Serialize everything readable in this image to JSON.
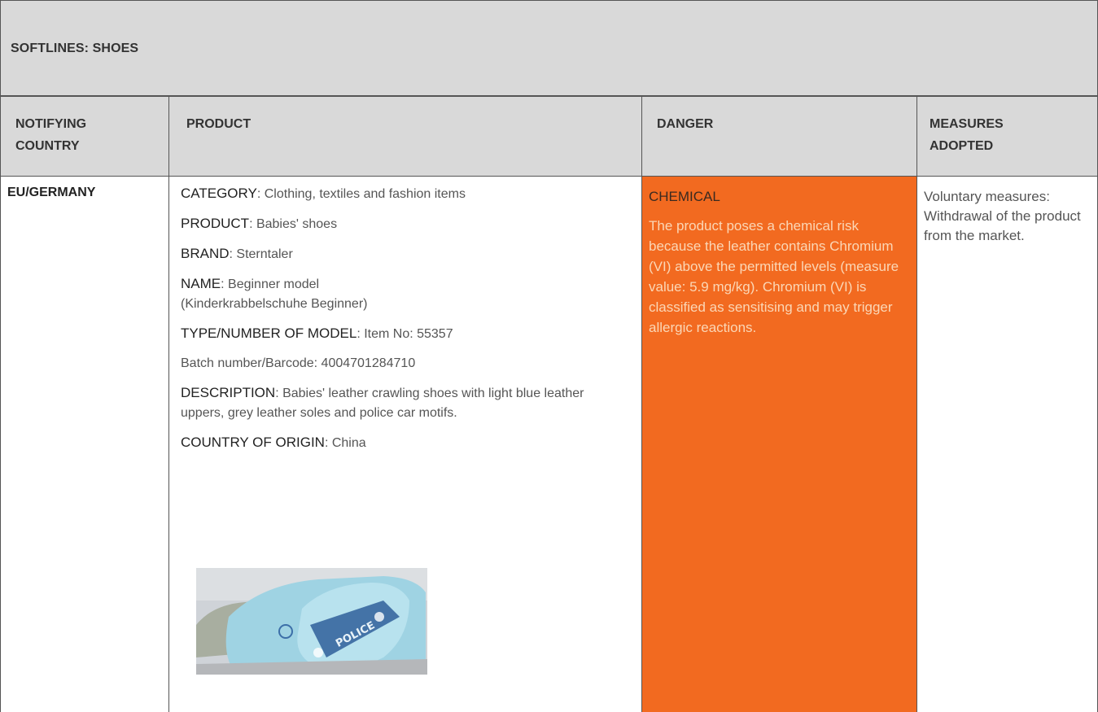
{
  "section": {
    "title": "SOFTLINES: SHOES"
  },
  "columns": {
    "country_line1": "NOTIFYING",
    "country_line2": "COUNTRY",
    "product": "PRODUCT",
    "danger": "DANGER",
    "measures_line1": "MEASURES",
    "measures_line2": "ADOPTED"
  },
  "row": {
    "country": "EU/GERMANY",
    "product": {
      "category_key": "CATEGORY",
      "category_val": ": Clothing, textiles and fashion items",
      "product_key": "PRODUCT",
      "product_val": ": Babies' shoes",
      "brand_key": "BRAND",
      "brand_val": ": Sterntaler",
      "name_key": "NAME",
      "name_val": ": Beginner model (Kinderkrabbelschuhe Beginner)",
      "type_key": "TYPE/NUMBER OF MODEL",
      "type_val": ": Item No: 55357",
      "batch": "Batch number/Barcode: 4004701284710",
      "description_key": "DESCRIPTION",
      "description_val": ": Babies' leather crawling shoes with light blue leather uppers, grey leather soles and police car motifs.",
      "origin_key": "COUNTRY OF ORIGIN",
      "origin_val": ": China",
      "photo_text": "POLICE"
    },
    "danger": {
      "title": "CHEMICAL",
      "text": "The product poses a chemical risk because the leather contains Chromium (VI) above the permitted levels (measure value: 5.9 mg/kg). Chromium (VI) is classified as sensitising and may trigger allergic reactions."
    },
    "measures": {
      "text": "Voluntary measures: Withdrawal of the product from the market."
    }
  },
  "colors": {
    "header_bg": "#d9d9d9",
    "danger_bg": "#f26a20",
    "rule": "#555555"
  }
}
